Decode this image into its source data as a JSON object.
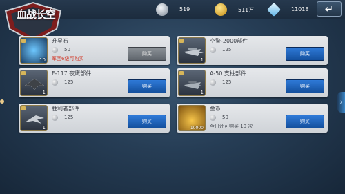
{
  "header": {
    "logo_text": "血战长空",
    "logo_tag": "店",
    "resources": [
      {
        "icon": "medal-icon",
        "value": "519"
      },
      {
        "icon": "gold-coin-icon",
        "value": "511万"
      },
      {
        "icon": "diamond-icon",
        "value": "11018"
      }
    ],
    "back_icon": "back-arrow-icon"
  },
  "items": [
    {
      "name": "升星石",
      "price": "50",
      "note": "军团6级可购买",
      "note_color": "#d23a2a",
      "button": "购买",
      "disabled": true,
      "qty": "10",
      "icon": "star-stone-icon"
    },
    {
      "name": "空警-2000部件",
      "price": "125",
      "note": "",
      "button": "购买",
      "disabled": false,
      "qty": "1",
      "icon": "awacs-plane-icon"
    },
    {
      "name": "F-117 夜鹰部件",
      "price": "125",
      "note": "",
      "button": "购买",
      "disabled": false,
      "qty": "1",
      "icon": "stealth-jet-icon"
    },
    {
      "name": "A-50 支柱部件",
      "price": "125",
      "note": "",
      "button": "购买",
      "disabled": false,
      "qty": "1",
      "icon": "a50-plane-icon"
    },
    {
      "name": "胜利者部件",
      "price": "125",
      "note": "",
      "button": "购买",
      "disabled": false,
      "qty": "1",
      "icon": "victor-bomber-icon"
    },
    {
      "name": "金币",
      "price": "50",
      "note": "今日还可购买 10 次",
      "note_color": "#4a4f57",
      "button": "购买",
      "disabled": false,
      "qty": "10000",
      "icon": "gold-coins-icon"
    }
  ]
}
